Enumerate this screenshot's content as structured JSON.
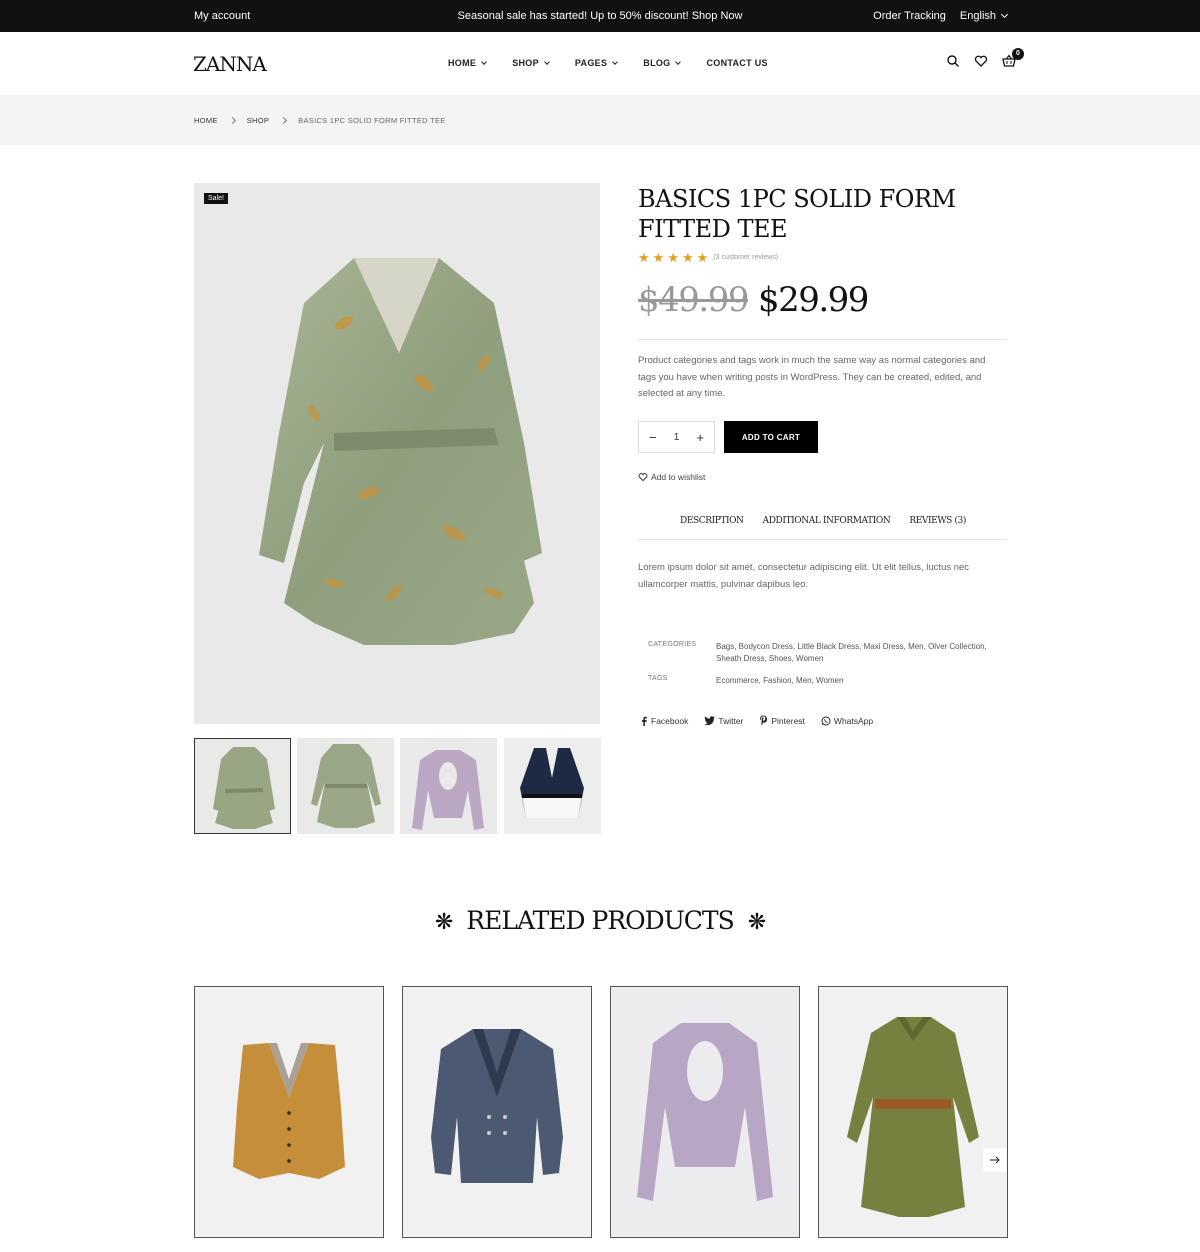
{
  "topbar": {
    "account": "My account",
    "promo": "Seasonal sale has started! Up to 50% discount! Shop Now",
    "order_tracking": "Order Tracking",
    "language": "English"
  },
  "header": {
    "logo": "ZANNA",
    "nav": [
      {
        "label": "HOME",
        "dropdown": true
      },
      {
        "label": "SHOP",
        "dropdown": true
      },
      {
        "label": "PAGES",
        "dropdown": true
      },
      {
        "label": "BLOG",
        "dropdown": true
      },
      {
        "label": "CONTACT US",
        "dropdown": false
      }
    ],
    "cart_count": "0",
    "icons": [
      "search-icon",
      "heart-icon",
      "basket-icon"
    ]
  },
  "breadcrumb": {
    "items": [
      "HOME",
      "SHOP"
    ],
    "current": "BASICS 1PC SOLID FORM FITTED TEE"
  },
  "gallery": {
    "sale_badge": "Sale!",
    "thumbnail_count": 4,
    "active_thumbnail": 1
  },
  "product": {
    "title": "BASICS 1PC SOLID FORM FITTED TEE",
    "rating": 5,
    "reviews_text": "(3 customer reviews)",
    "old_price": "$49.99",
    "price": "$29.99",
    "description": "Product categories and tags work in much the same way as normal categories and tags you have when writing posts in WordPress. They can be created, edited, and selected at any time.",
    "quantity": "1",
    "add_to_cart": "ADD TO CART",
    "wishlist": "Add to wishlist",
    "tabs": [
      "DESCRIPTION",
      "ADDITIONAL INFORMATION",
      "REVIEWS (3)"
    ],
    "tab_text": "Lorem ipsum dolor sit amet, consectetur adipiscing elit. Ut elit tellus, luctus nec ullamcorper mattis, pulvinar dapibus leo.",
    "categories_label": "CATEGORIES",
    "categories": "Bags, Bodycon Dress, Little Black Dress, Maxi Dress, Men, Olver Collection, Sheath Dress, Shoes, Women",
    "tags_label": "TAGS",
    "tags": "Ecommerce, Fashion, Men, Women",
    "share": [
      "Facebook",
      "Twitter",
      "Pinterest",
      "WhatsApp"
    ]
  },
  "related": {
    "title": "RELATED PRODUCTS",
    "ornament": "❋",
    "cards": [
      "vest",
      "blazer",
      "bodysuit",
      "shirt-dress"
    ]
  },
  "colors": {
    "topbar_bg": "#111111",
    "accent_black": "#000000",
    "star": "#e0a020",
    "breadcrumb_bg": "#f4f4f4"
  }
}
